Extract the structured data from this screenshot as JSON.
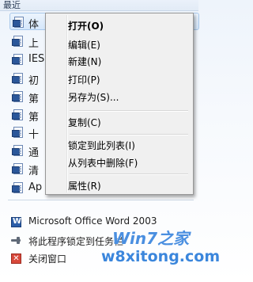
{
  "recent": {
    "header": "最近",
    "items": [
      "体",
      "上",
      "IES",
      "初",
      "第",
      "第",
      "十",
      "通",
      "清",
      "Ap"
    ]
  },
  "tasks": {
    "program": "Microsoft Office Word 2003",
    "pin": "将此程序锁定到任务栏",
    "close": "关闭窗口"
  },
  "context_menu": {
    "open": "打开(O)",
    "edit": "编辑(E)",
    "new": "新建(N)",
    "print": "打印(P)",
    "save_as": "另存为(S)...",
    "copy": "复制(C)",
    "lock_to_list": "锁定到此列表(I)",
    "remove_from_list": "从列表中删除(F)",
    "properties": "属性(R)"
  },
  "watermark": {
    "brand": "Win7之家",
    "url": "w8xitong.com"
  }
}
